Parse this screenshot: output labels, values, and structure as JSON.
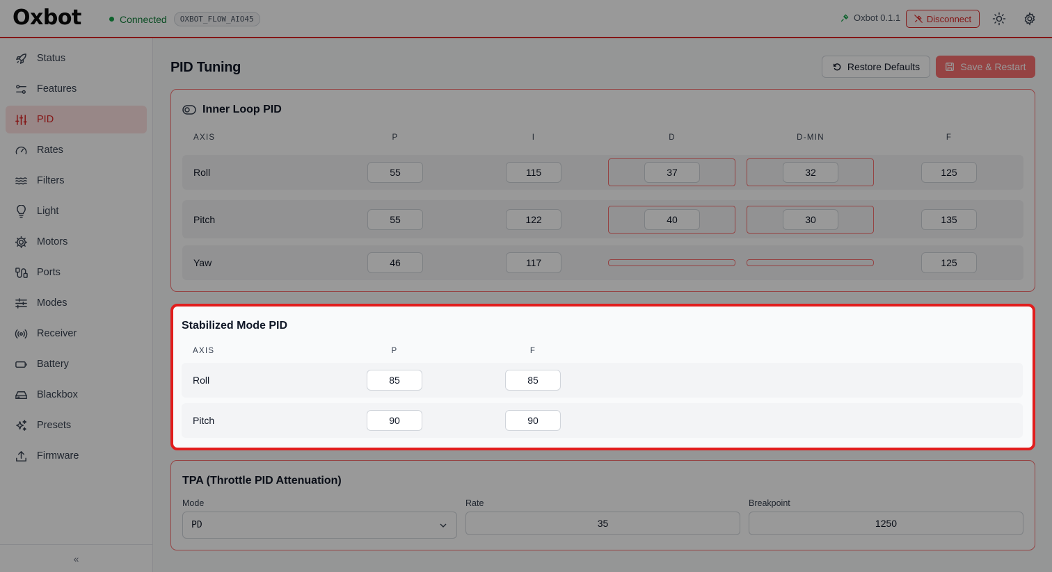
{
  "header": {
    "logo": "Oxbot",
    "status": "Connected",
    "device": "OXBOT_FLOW_AIO45",
    "version": "Oxbot 0.1.1",
    "disconnect_label": "Disconnect"
  },
  "sidebar": {
    "items": [
      {
        "label": "Status",
        "icon": "rocket-icon"
      },
      {
        "label": "Features",
        "icon": "toggles-icon"
      },
      {
        "label": "PID",
        "icon": "sliders-icon"
      },
      {
        "label": "Rates",
        "icon": "gauge-icon"
      },
      {
        "label": "Filters",
        "icon": "waves-icon"
      },
      {
        "label": "Light",
        "icon": "lightbulb-icon"
      },
      {
        "label": "Motors",
        "icon": "cog-icon"
      },
      {
        "label": "Ports",
        "icon": "plug-icon"
      },
      {
        "label": "Modes",
        "icon": "sliders-horizontal-icon"
      },
      {
        "label": "Receiver",
        "icon": "radio-icon"
      },
      {
        "label": "Battery",
        "icon": "battery-icon"
      },
      {
        "label": "Blackbox",
        "icon": "drive-icon"
      },
      {
        "label": "Presets",
        "icon": "sparkles-icon"
      },
      {
        "label": "Firmware",
        "icon": "upload-icon"
      }
    ],
    "active": "PID",
    "collapse_label": "«"
  },
  "page": {
    "title": "PID Tuning",
    "restore_label": "Restore Defaults",
    "save_label": "Save & Restart"
  },
  "inner_loop": {
    "title": "Inner Loop PID",
    "columns": [
      "AXIS",
      "P",
      "I",
      "D",
      "D-MIN",
      "F"
    ],
    "rows": [
      {
        "axis": "Roll",
        "p": "55",
        "i": "115",
        "d": "37",
        "dmin": "32",
        "f": "125"
      },
      {
        "axis": "Pitch",
        "p": "55",
        "i": "122",
        "d": "40",
        "dmin": "30",
        "f": "135"
      },
      {
        "axis": "Yaw",
        "p": "46",
        "i": "117",
        "d": "",
        "dmin": "",
        "f": "125"
      }
    ]
  },
  "stabilized": {
    "title": "Stabilized Mode PID",
    "columns": [
      "AXIS",
      "P",
      "F"
    ],
    "rows": [
      {
        "axis": "Roll",
        "p": "85",
        "f": "85"
      },
      {
        "axis": "Pitch",
        "p": "90",
        "f": "90"
      }
    ]
  },
  "tpa": {
    "title": "TPA (Throttle PID Attenuation)",
    "mode_label": "Mode",
    "mode_value": "PD",
    "rate_label": "Rate",
    "rate_value": "35",
    "breakpoint_label": "Breakpoint",
    "breakpoint_value": "1250"
  },
  "colors": {
    "accent": "#dc2626",
    "connected": "#16a34a",
    "highlight_border": "#e11d1d"
  }
}
